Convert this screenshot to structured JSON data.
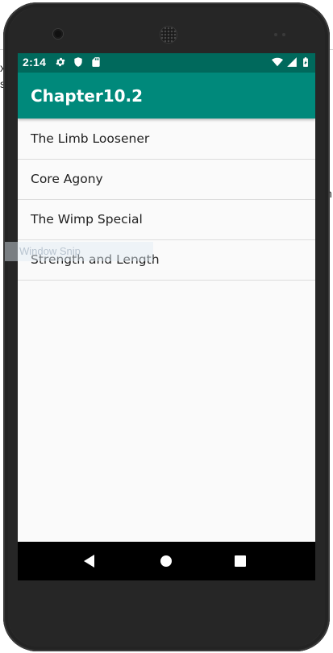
{
  "status_bar": {
    "time": "2:14",
    "background_color": "#00695c",
    "icons": [
      "gear-icon",
      "shield-icon",
      "sd-card-icon",
      "wifi-icon",
      "signal-icon",
      "battery-icon"
    ]
  },
  "app_bar": {
    "title": "Chapter10.2",
    "color": "#00897b"
  },
  "list": {
    "items": [
      {
        "label": "The Limb Loosener"
      },
      {
        "label": "Core Agony"
      },
      {
        "label": "The Wimp Special"
      },
      {
        "label": "Strength and Length"
      }
    ]
  },
  "nav_bar": {
    "buttons": [
      "back-icon",
      "home-icon",
      "recents-icon"
    ]
  },
  "background_fragments": {
    "left_top": "x",
    "left_mid": "s",
    "right_mid": "n",
    "tooltip": "Window Snip"
  }
}
